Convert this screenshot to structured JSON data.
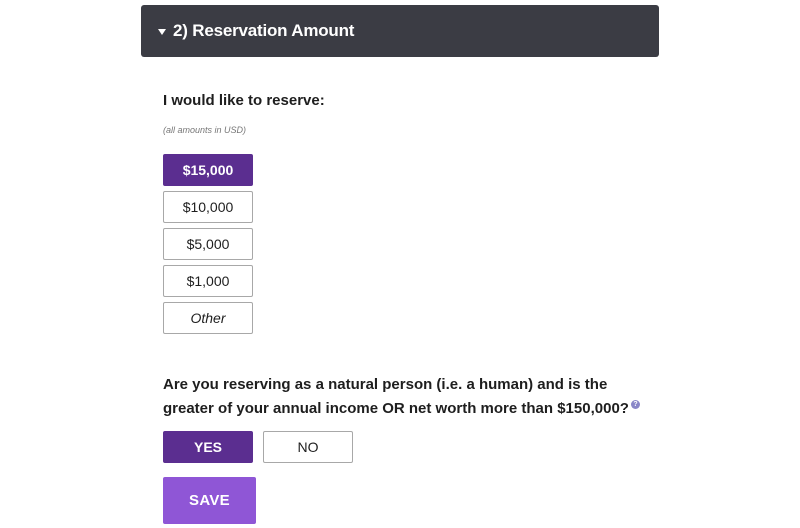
{
  "section": {
    "title": "2) Reservation Amount",
    "expand_icon": "triangle-down-icon"
  },
  "reserve": {
    "question": "I would like to reserve:",
    "note": "(all amounts in USD)",
    "options": [
      {
        "label": "$15,000",
        "selected": true
      },
      {
        "label": "$10,000",
        "selected": false
      },
      {
        "label": "$5,000",
        "selected": false
      },
      {
        "label": "$1,000",
        "selected": false
      },
      {
        "label": "Other",
        "selected": false
      }
    ]
  },
  "accreditation": {
    "question": "Are you reserving as a natural person (i.e. a human) and is the greater of your annual income OR net worth more than $150,000?",
    "help_icon": "question-mark-icon",
    "help_glyph": "?",
    "yes_label": "YES",
    "no_label": "NO",
    "selected": "yes"
  },
  "save_label": "SAVE",
  "colors": {
    "header_bg": "#3b3c44",
    "selected": "#5b2e90",
    "save": "#8f56d6",
    "help": "#8a87c8"
  }
}
